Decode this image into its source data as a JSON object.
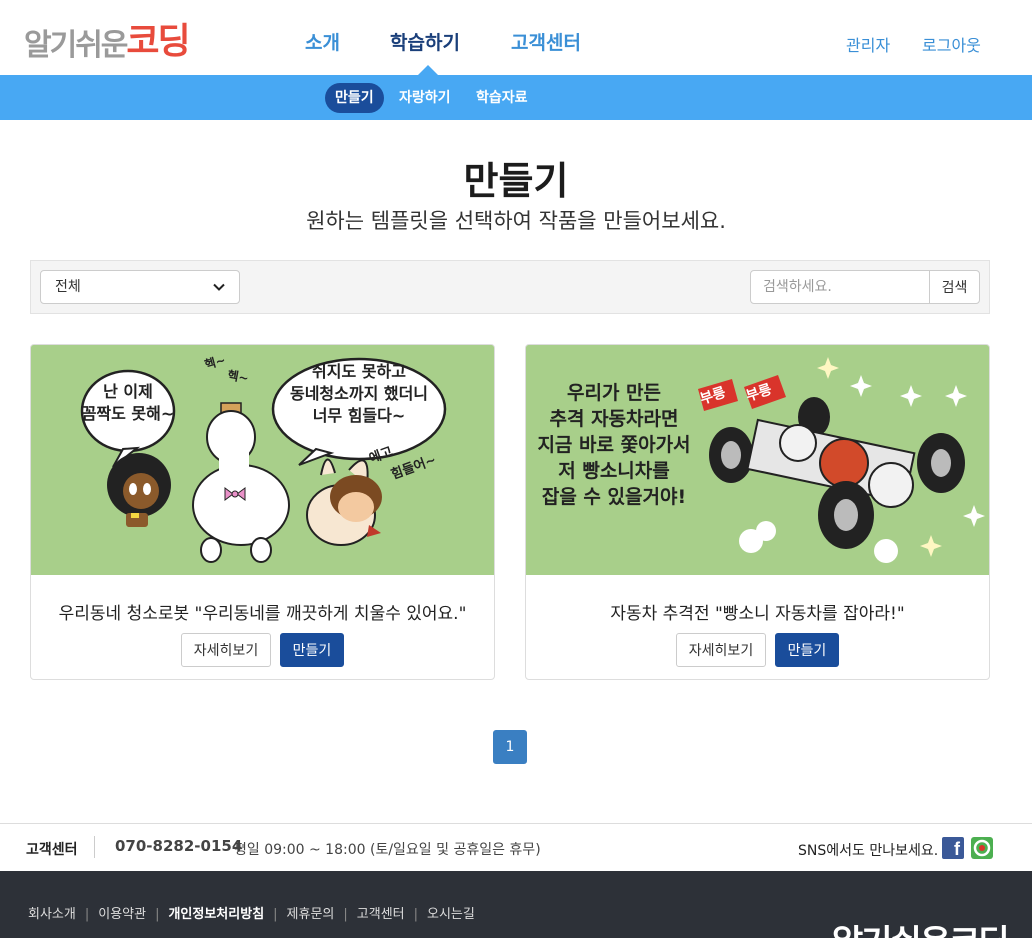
{
  "header": {
    "logo": {
      "part1": "알기쉬운",
      "part2": "코딩"
    },
    "nav": [
      {
        "label": "소개"
      },
      {
        "label": "학습하기"
      },
      {
        "label": "고객센터"
      }
    ],
    "admin_link": "관리자",
    "logout_link": "로그아웃"
  },
  "subnav": [
    {
      "label": "만들기"
    },
    {
      "label": "자랑하기"
    },
    {
      "label": "학습자료"
    }
  ],
  "page": {
    "title": "만들기",
    "subtitle": "원하는 템플릿을 선택하여 작품을 만들어보세요."
  },
  "filter": {
    "category_selected": "전체",
    "search_placeholder": "검색하세요.",
    "search_button": "검색"
  },
  "cards": [
    {
      "title": "우리동네 청소로봇 \"우리동네를 깨끗하게 치울수 있어요.\"",
      "detail_button": "자세히보기",
      "make_button": "만들기",
      "bubble_left": [
        "난 이제",
        "꼼짝도 못해~"
      ],
      "bubble_right": [
        "쉬지도 못하고",
        "동네청소까지 했더니",
        "너무 힘들다~"
      ],
      "sfx_top": [
        "헥~",
        "헥~"
      ],
      "sfx_right": [
        "에고",
        "힘들어~"
      ]
    },
    {
      "title": "자동차 추격전 \"빵소니 자동차를 잡아라!\"",
      "detail_button": "자세히보기",
      "make_button": "만들기",
      "caption": [
        "우리가 만든",
        "추격 자동차라면",
        "지금 바로 쫓아가서",
        "저 빵소니차를",
        "잡을 수 있을거야!"
      ],
      "sfx1": "부릉",
      "sfx2": "부릉"
    }
  ],
  "pagination": {
    "current": "1"
  },
  "footer": {
    "cs_label": "고객센터",
    "phone": "070-8282-0154",
    "hours": "평일 09:00 ~ 18:00 (토/일요일 및 공휴일은 휴무)",
    "sns_text": "SNS에서도 만나보세요.",
    "fb_letter": "f",
    "links": [
      "회사소개",
      "이용약관",
      "개인정보처리방침",
      "제휴문의",
      "고객센터",
      "오시는길"
    ],
    "bottom_logo": "알기쉬운코딩"
  },
  "colors": {
    "accent_blue": "#48a8f3",
    "primary_navy": "#1a4d9b",
    "nav_text": "#3a8fd6",
    "card_bg": "#a8cf8a",
    "footer_dark": "#2d3138"
  }
}
